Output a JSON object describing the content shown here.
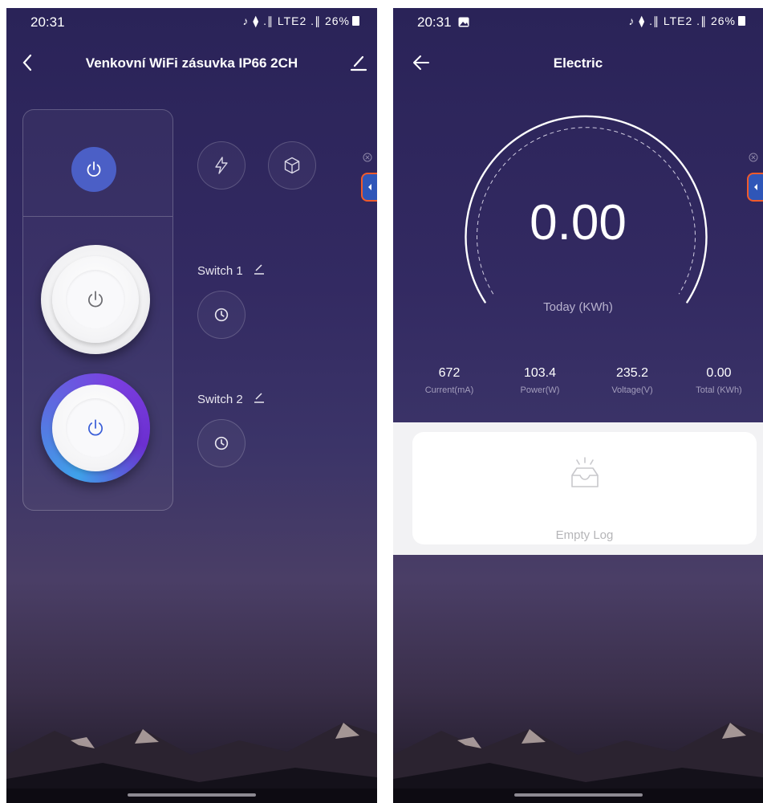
{
  "left": {
    "status": {
      "time": "20:31",
      "icons": "♪ ⧫ .∥ LTE2 .∥",
      "battery": "26%"
    },
    "header": {
      "title": "Venkovní WiFi zásuvka IP66 2CH"
    },
    "switches": [
      {
        "label": "Switch 1",
        "state": "off"
      },
      {
        "label": "Switch 2",
        "state": "on"
      }
    ]
  },
  "right": {
    "status": {
      "time": "20:31",
      "icons": "♪ ⧫ .∥ LTE2 .∥",
      "battery": "26%"
    },
    "header": {
      "title": "Electric"
    },
    "today": {
      "value": "0.00",
      "label": "Today (KWh)"
    },
    "stats": [
      {
        "value": "672",
        "label": "Current(mA)"
      },
      {
        "value": "103.4",
        "label": "Power(W)"
      },
      {
        "value": "235.2",
        "label": "Voltage(V)"
      },
      {
        "value": "0.00",
        "label": "Total (KWh)"
      }
    ],
    "log": {
      "empty_text": "Empty Log"
    }
  },
  "colors": {
    "accent": "#4b5fc6",
    "background": "#2a2358",
    "tab_border": "#f15a2a"
  }
}
